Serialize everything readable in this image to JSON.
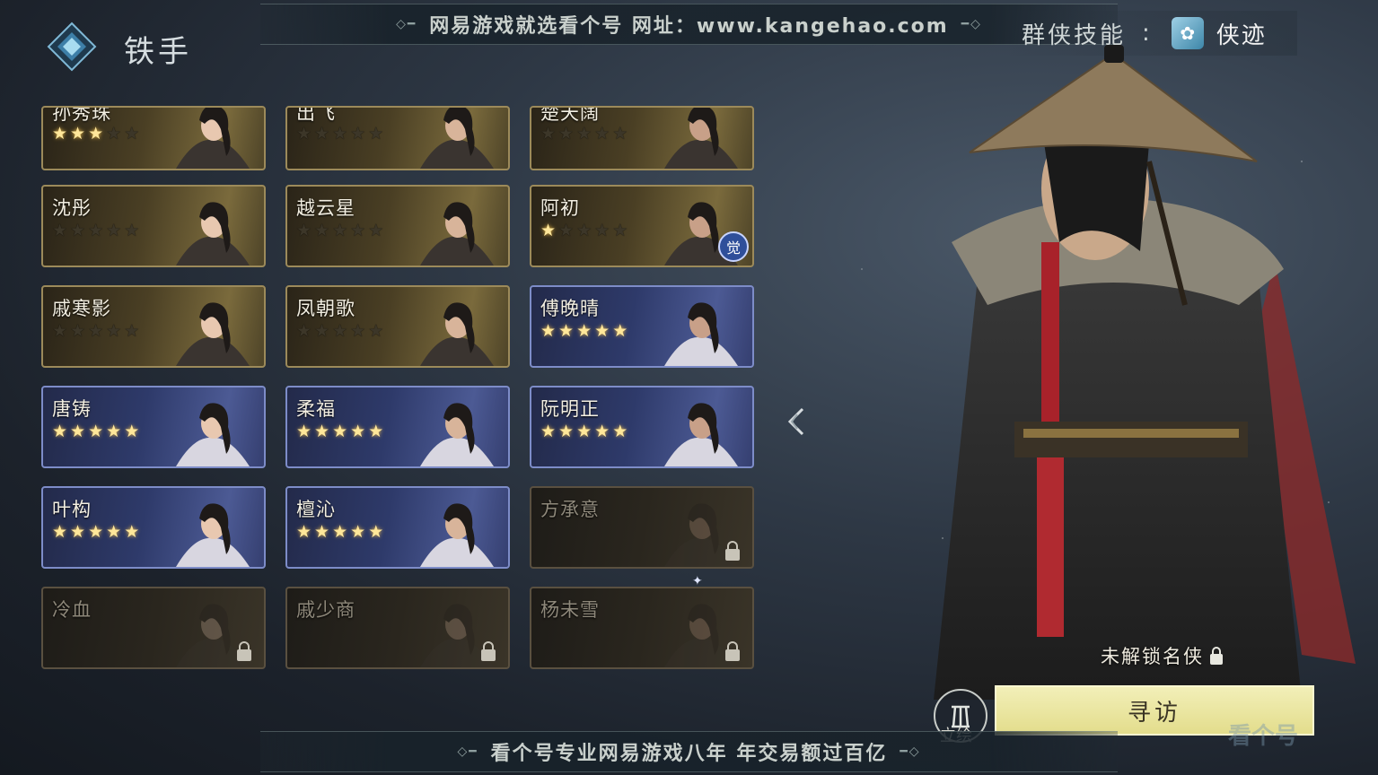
{
  "header": {
    "title": "铁手",
    "top_banner": "网易游戏就选看个号   网址：www.kangehao.com",
    "bottom_banner": "看个号专业网易游戏八年   年交易额过百亿",
    "skill_label": "群侠技能",
    "skill_colon": ":",
    "xiaji_label": "侠迹"
  },
  "cards": [
    {
      "name": "孙秀珠",
      "stars": 3,
      "style": "gold",
      "state": "partial"
    },
    {
      "name": "出飞",
      "stars": 0,
      "style": "gold",
      "state": "partial"
    },
    {
      "name": "楚天阔",
      "stars": 0,
      "style": "gold",
      "state": "partial"
    },
    {
      "name": "沈彤",
      "stars": 0,
      "style": "gold",
      "state": "normal"
    },
    {
      "name": "越云星",
      "stars": 0,
      "style": "gold",
      "state": "normal"
    },
    {
      "name": "阿初",
      "stars": 1,
      "style": "gold",
      "state": "normal",
      "badge": "觉"
    },
    {
      "name": "戚寒影",
      "stars": 0,
      "style": "gold",
      "state": "normal"
    },
    {
      "name": "凤朝歌",
      "stars": 0,
      "style": "gold",
      "state": "normal"
    },
    {
      "name": "傅晚晴",
      "stars": 5,
      "style": "blue",
      "state": "normal"
    },
    {
      "name": "唐铸",
      "stars": 5,
      "style": "blue",
      "state": "normal"
    },
    {
      "name": "柔福",
      "stars": 5,
      "style": "blue",
      "state": "normal"
    },
    {
      "name": "阮明正",
      "stars": 5,
      "style": "blue",
      "state": "normal"
    },
    {
      "name": "叶构",
      "stars": 5,
      "style": "blue",
      "state": "normal"
    },
    {
      "name": "檀沁",
      "stars": 5,
      "style": "blue",
      "state": "normal"
    },
    {
      "name": "方承意",
      "stars": 0,
      "style": "locked",
      "state": "locked"
    },
    {
      "name": "冷血",
      "stars": 0,
      "style": "locked",
      "state": "locked"
    },
    {
      "name": "戚少商",
      "stars": 0,
      "style": "locked",
      "state": "locked"
    },
    {
      "name": "杨未雪",
      "stars": 0,
      "style": "locked",
      "state": "locked"
    }
  ],
  "hero": {
    "unlock_text": "未解锁名侠",
    "visit_button": "寻访",
    "lihui_label": "立绘"
  },
  "watermark": "看个号",
  "colors": {
    "gold_star": "#ffe79a",
    "visit_bg": "#e3dd8c",
    "blue_card": "#2e3a6a",
    "gold_card": "#4a3f24"
  }
}
